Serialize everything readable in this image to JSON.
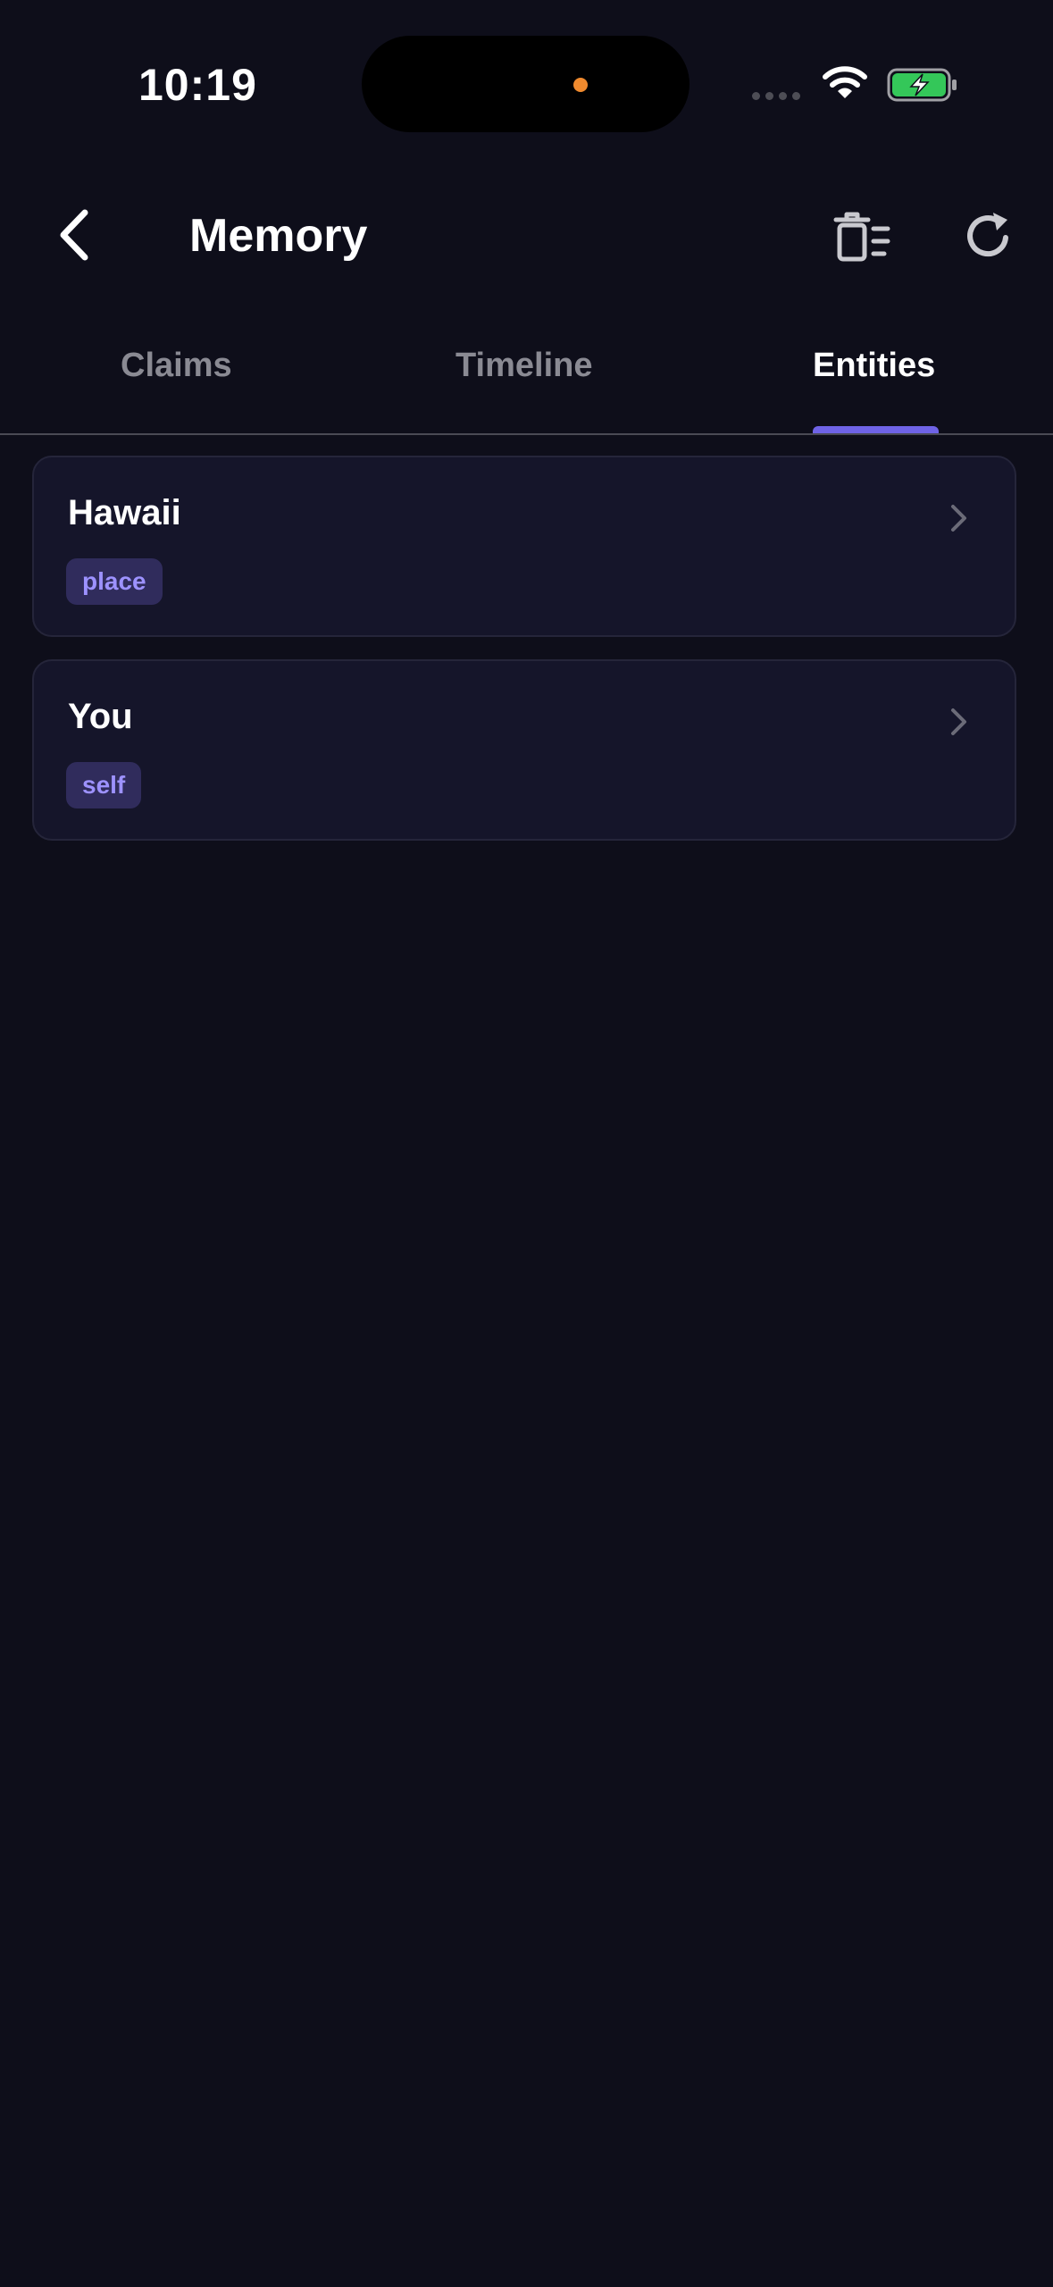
{
  "status_bar": {
    "time": "10:19",
    "island_dot_color": "#f08a2e",
    "battery_color": "#34c759",
    "icons": [
      "wifi-icon",
      "battery-charging-icon",
      "signal-icon"
    ]
  },
  "header": {
    "title": "Memory",
    "back_icon": "chevron-left-icon",
    "actions": [
      "delete-list-icon",
      "refresh-icon"
    ]
  },
  "tabs": {
    "items": [
      {
        "label": "Claims",
        "active": false
      },
      {
        "label": "Timeline",
        "active": false
      },
      {
        "label": "Entities",
        "active": true
      }
    ],
    "accent_color": "#6f63e6"
  },
  "entities": [
    {
      "name": "Hawaii",
      "type": "place"
    },
    {
      "name": "You",
      "type": "self"
    }
  ],
  "colors": {
    "background": "#0e0e1a",
    "card": "#15152a",
    "badge_bg": "#302c5c",
    "badge_text": "#9d92ff"
  }
}
